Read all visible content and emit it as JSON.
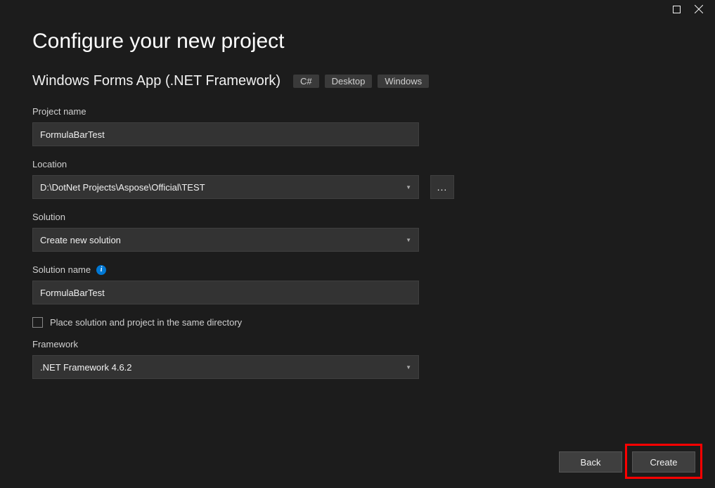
{
  "header": {
    "title": "Configure your new project",
    "subtitle": "Windows Forms App (.NET Framework)",
    "tags": [
      "C#",
      "Desktop",
      "Windows"
    ]
  },
  "form": {
    "projectName": {
      "label": "Project name",
      "value": "FormulaBarTest"
    },
    "location": {
      "label": "Location",
      "value": "D:\\DotNet Projects\\Aspose\\Official\\TEST",
      "browse": "..."
    },
    "solution": {
      "label": "Solution",
      "value": "Create new solution"
    },
    "solutionName": {
      "label": "Solution name",
      "value": "FormulaBarTest"
    },
    "sameDir": {
      "label": "Place solution and project in the same directory",
      "checked": false
    },
    "framework": {
      "label": "Framework",
      "value": ".NET Framework 4.6.2"
    }
  },
  "footer": {
    "back": "Back",
    "create": "Create"
  }
}
